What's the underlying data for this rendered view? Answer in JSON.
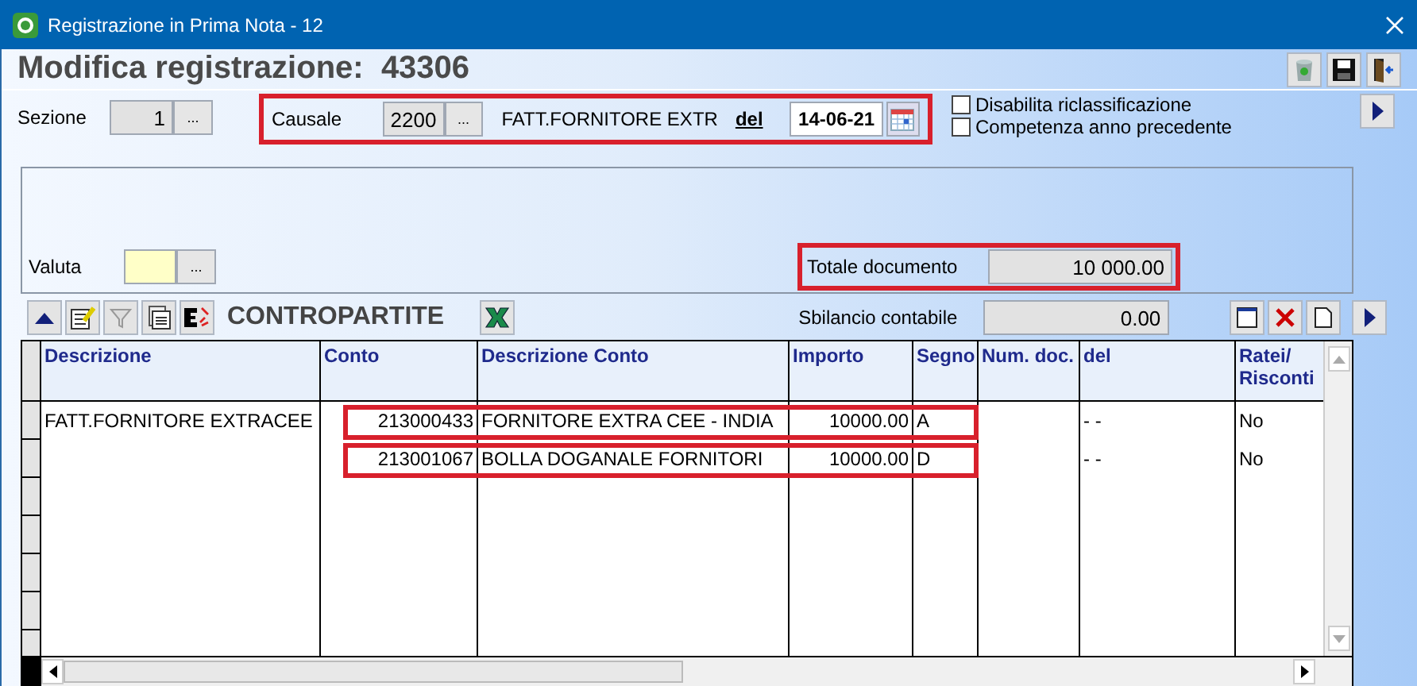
{
  "window": {
    "title": "Registrazione in Prima Nota - 12"
  },
  "header": {
    "title": "Modifica registrazione:",
    "number": "43306"
  },
  "sezione": {
    "label": "Sezione",
    "value": "1",
    "button": "..."
  },
  "causale": {
    "highlighted": true,
    "label": "Causale",
    "code": "2200",
    "button": "...",
    "description": "FATT.FORNITORE EXTR",
    "date_label": "del",
    "date": "14-06-21"
  },
  "options": [
    {
      "label": "Disabilita riclassificazione",
      "checked": false
    },
    {
      "label": "Competenza anno precedente",
      "checked": false
    }
  ],
  "valuta": {
    "label": "Valuta",
    "button": "..."
  },
  "totale": {
    "highlighted": true,
    "label": "Totale documento",
    "value": "10 000.00"
  },
  "contropartite": {
    "title": "CONTROPARTITE",
    "sbilancio_label": "Sbilancio contabile",
    "sbilancio": "0.00"
  },
  "table": {
    "columns": [
      "Descrizione",
      "Conto",
      "Descrizione Conto",
      "Importo",
      "Segno",
      "Num. doc.",
      "del",
      "Ratei/ Risconti"
    ],
    "rows": [
      {
        "highlighted": true,
        "descrizione": "FATT.FORNITORE EXTRACEE",
        "conto": "213000433",
        "descrizione_conto": "FORNITORE EXTRA CEE - INDIA",
        "importo": "10000.00",
        "segno": "A",
        "del": "- -",
        "ratei": "No"
      },
      {
        "highlighted": true,
        "conto": "213001067",
        "descrizione_conto": "BOLLA DOGANALE FORNITORI",
        "importo": "10000.00",
        "segno": "D",
        "del": "- -",
        "ratei": "No"
      }
    ]
  }
}
